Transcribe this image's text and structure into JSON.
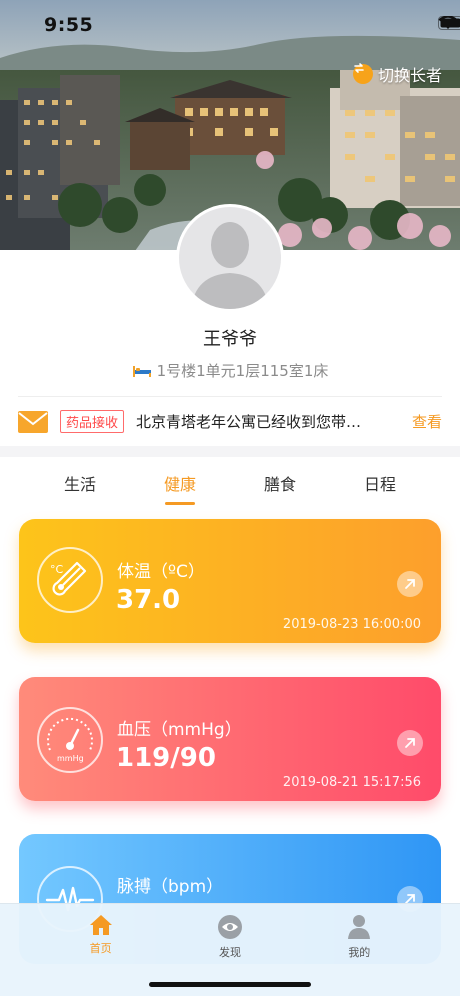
{
  "status_bar": {
    "time": "9:55"
  },
  "header": {
    "switch_elder_label": "切换长者"
  },
  "profile": {
    "name": "王爷爷",
    "room": "1号楼1单元1层115室1床"
  },
  "notice": {
    "tag": "药品接收",
    "message": "北京青塔老年公寓已经收到您带…",
    "view_label": "查看"
  },
  "tabs": [
    {
      "label": "生活",
      "active": false
    },
    {
      "label": "健康",
      "active": true
    },
    {
      "label": "膳食",
      "active": false
    },
    {
      "label": "日程",
      "active": false
    }
  ],
  "health_cards": [
    {
      "label": "体温（ºC）",
      "value": "37.0",
      "time": "2019-08-23 16:00:00",
      "icon": "thermometer-icon"
    },
    {
      "label": "血压（mmHg）",
      "value": "119/90",
      "time": "2019-08-21 15:17:56",
      "icon": "gauge-icon",
      "icon_text": "mmHg"
    },
    {
      "label": "脉搏（bpm）",
      "icon": "pulse-icon"
    }
  ],
  "tabbar": [
    {
      "label": "首页",
      "icon": "home-icon",
      "active": true
    },
    {
      "label": "发现",
      "icon": "eye-icon",
      "active": false
    },
    {
      "label": "我的",
      "icon": "person-icon",
      "active": false
    }
  ],
  "colors": {
    "accent": "#f59a23",
    "temp_card": [
      "#fdc41a",
      "#fd9f2c"
    ],
    "bp_card": [
      "#ff8b7a",
      "#ff4b6a"
    ],
    "pulse_card": [
      "#74c8ff",
      "#2f96f5"
    ]
  }
}
